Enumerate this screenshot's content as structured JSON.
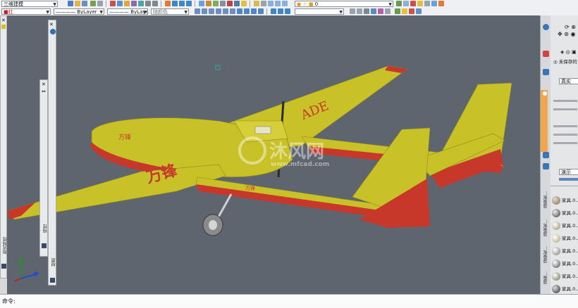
{
  "toolbar": {
    "view_combo": "三维建模",
    "color_combo": "■红",
    "linetype_combo": "———— ByLayer",
    "lineweight_combo": "———— ByLayer",
    "plotstyle_combo": "随颜色",
    "layer_combo": "0"
  },
  "left_palettes": {
    "palette1_title": "阳光特性",
    "palette2_title": "特性",
    "palette3_title": "材质"
  },
  "right_panel": {
    "unsaved_label": "未保存的",
    "visual_style_value": "真实",
    "render_preset_value": "演示",
    "tabs": [
      "渲染化...",
      "渲染化...",
      "渲染化...",
      "渲染..."
    ],
    "materials": [
      "家具.0...",
      "家具.0...",
      "家具.0...",
      "家具.0...",
      "家具.0...",
      "家具.0...",
      "家具.0...",
      "家具.0...",
      "家具.0..."
    ]
  },
  "model_text": {
    "wing_text": "ADE",
    "fuselage_mark": "万锋"
  },
  "watermark": {
    "main": "沐风网",
    "url": "www.mfcad.com"
  },
  "command_line": {
    "prompt": "命令:"
  },
  "colors": {
    "viewport_bg": "#5f656f",
    "airframe_yellow": "#c8c128",
    "airframe_red": "#c8382a",
    "accent_orange": "#f0a64c"
  }
}
